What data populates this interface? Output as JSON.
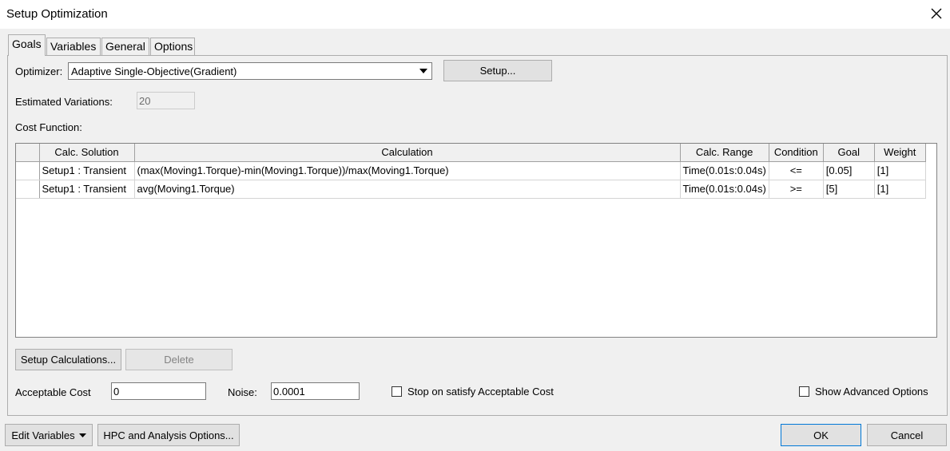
{
  "window": {
    "title": "Setup Optimization"
  },
  "tabs": [
    {
      "label": "Goals",
      "active": true
    },
    {
      "label": "Variables",
      "active": false
    },
    {
      "label": "General",
      "active": false
    },
    {
      "label": "Options",
      "active": false
    }
  ],
  "goals": {
    "optimizer_label": "Optimizer:",
    "optimizer_value": "Adaptive Single-Objective(Gradient)",
    "setup_button": "Setup...",
    "estimated_variations_label": "Estimated Variations:",
    "estimated_variations_value": "20",
    "cost_function_label": "Cost Function:",
    "table": {
      "columns": [
        "Calc. Solution",
        "Calculation",
        "Calc. Range",
        "Condition",
        "Goal",
        "Weight"
      ],
      "rows": [
        {
          "solution": "Setup1 : Transient",
          "calculation": "(max(Moving1.Torque)-min(Moving1.Torque))/max(Moving1.Torque)",
          "range": "Time(0.01s:0.04s)",
          "condition": "<=",
          "goal": "[0.05]",
          "weight": "[1]"
        },
        {
          "solution": "Setup1 : Transient",
          "calculation": "avg(Moving1.Torque)",
          "range": "Time(0.01s:0.04s)",
          "condition": ">=",
          "goal": "[5]",
          "weight": "[1]"
        }
      ]
    },
    "setup_calculations_button": "Setup Calculations...",
    "delete_button": "Delete",
    "acceptable_cost_label": "Acceptable Cost",
    "acceptable_cost_value": "0",
    "noise_label": "Noise:",
    "noise_value": "0.0001",
    "stop_on_satisfy_label": "Stop on satisfy Acceptable Cost",
    "show_advanced_label": "Show Advanced Options"
  },
  "footer": {
    "edit_variables_button": "Edit Variables",
    "hpc_button": "HPC and Analysis Options...",
    "ok_button": "OK",
    "cancel_button": "Cancel"
  }
}
